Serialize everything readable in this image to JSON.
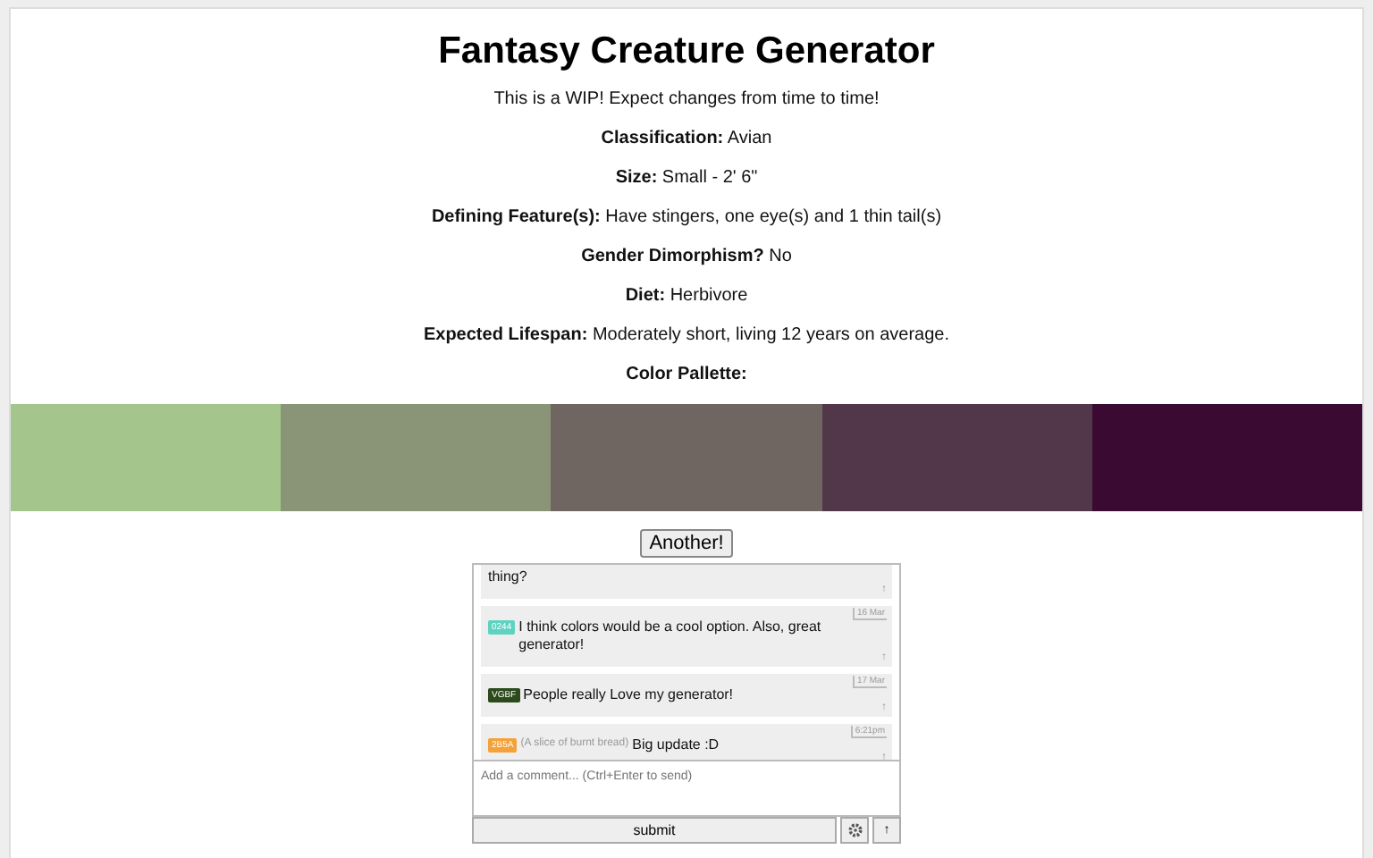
{
  "title": "Fantasy Creature Generator",
  "notice": "This is a WIP! Expect changes from time to time!",
  "facts": [
    {
      "label": "Classification:",
      "value": "Avian"
    },
    {
      "label": "Size:",
      "value": "Small - 2' 6\""
    },
    {
      "label": "Defining Feature(s):",
      "value": "Have stingers, one eye(s) and 1 thin tail(s)"
    },
    {
      "label": "Gender Dimorphism?",
      "value": "No"
    },
    {
      "label": "Diet:",
      "value": "Herbivore"
    },
    {
      "label": "Expected Lifespan:",
      "value": "Moderately short, living 12 years on average."
    },
    {
      "label": "Color Pallette:"
    }
  ],
  "palette": [
    {
      "color": "#a4c68c"
    },
    {
      "color": "#8a9477"
    },
    {
      "color": "#706661"
    },
    {
      "color": "#523649"
    },
    {
      "color": "#3b0a33"
    }
  ],
  "another_button": "Another!",
  "comments": [
    {
      "text": "thing?",
      "vote": "↑"
    },
    {
      "badge": "0244",
      "color": "#5fd3c0",
      "text": "I think colors would be a cool option. Also, great generator!",
      "time": "16 Mar",
      "vote": "↑"
    },
    {
      "badge": "VGBF",
      "color": "#2c4a1c",
      "text": "People really Love my generator!",
      "time": "17 Mar",
      "vote": "↑"
    },
    {
      "badge": "2B5A",
      "color": "#f3a23a",
      "name": "(A slice of burnt bread)",
      "text": "Big update :D",
      "time": "6:21pm",
      "vote": "↑"
    }
  ],
  "comment_placeholder": "Add a comment... (Ctrl+Enter to send)",
  "submit_button": "submit",
  "extra_button": "↑"
}
